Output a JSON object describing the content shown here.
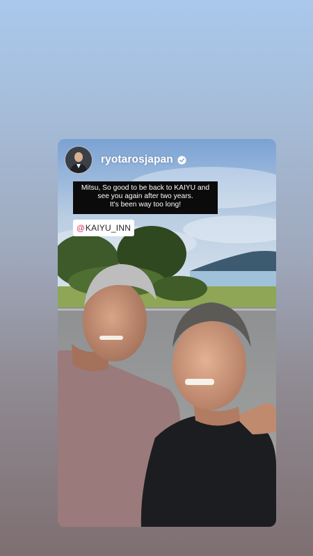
{
  "story": {
    "username": "ryotarosjapan",
    "caption_lines": [
      "Mitsu, So good to be back to KAIYU and",
      "see you again after two years.",
      "It's been way too long!"
    ],
    "mention": "KAIYU_INN"
  },
  "colors": {
    "background_top": "#a9c8ec",
    "background_bottom": "#7e6f71",
    "caption_bg": "#0b0b0b",
    "verified_badge": "#ffffff"
  },
  "icons": {
    "verified": "verified-badge-icon",
    "mention": "at-sign-icon"
  }
}
